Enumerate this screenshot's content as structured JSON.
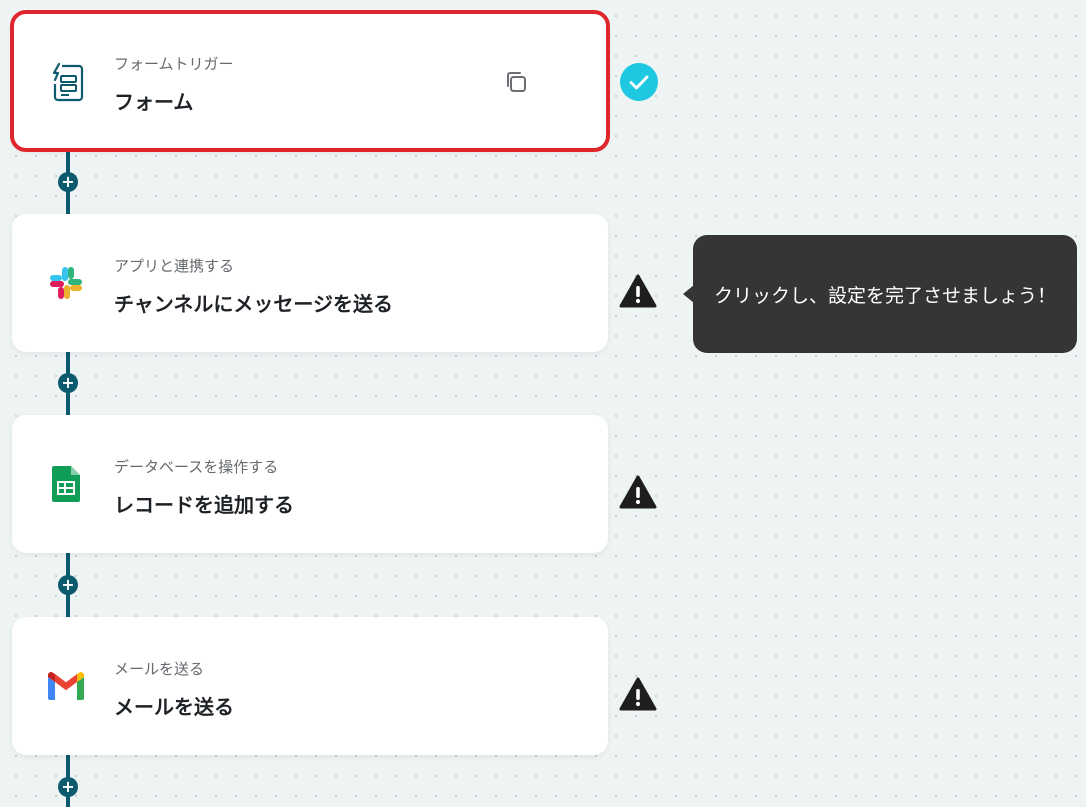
{
  "steps": [
    {
      "subtitle": "フォームトリガー",
      "title": "フォーム",
      "icon": "form-icon",
      "status": "complete"
    },
    {
      "subtitle": "アプリと連携する",
      "title": "チャンネルにメッセージを送る",
      "icon": "slack-icon",
      "status": "warning"
    },
    {
      "subtitle": "データベースを操作する",
      "title": "レコードを追加する",
      "icon": "sheets-icon",
      "status": "warning"
    },
    {
      "subtitle": "メールを送る",
      "title": "メールを送る",
      "icon": "gmail-icon",
      "status": "warning"
    }
  ],
  "add_button_glyph": "+",
  "tooltip": {
    "text": "クリックし、設定を完了させましょう！"
  },
  "colors": {
    "flow_line": "#0c5a6e",
    "selected_border": "#e0262d",
    "check": "#1ec8e0",
    "warning": "#1e1e1e",
    "tooltip_bg": "#353535"
  }
}
